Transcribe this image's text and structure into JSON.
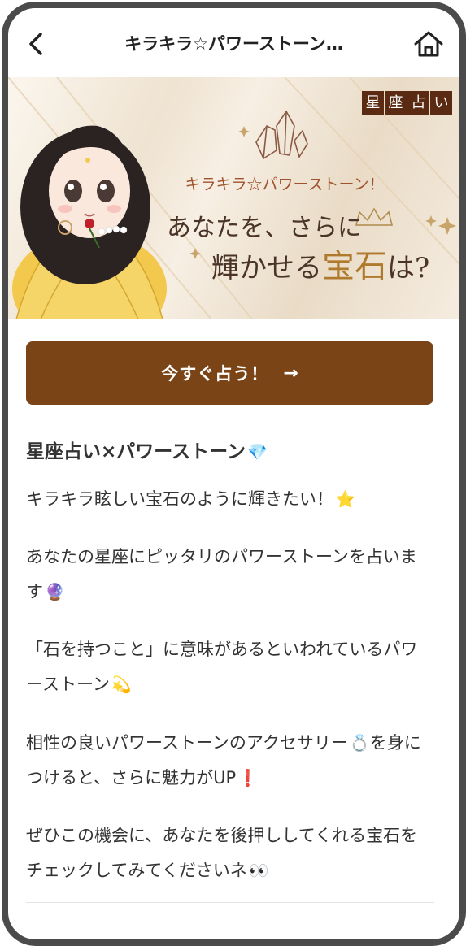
{
  "header": {
    "title": "キラキラ☆パワーストーン…",
    "back_icon": "chevron-left-icon",
    "home_icon": "home-icon"
  },
  "banner": {
    "badge": [
      "星",
      "座",
      "占",
      "い"
    ],
    "subtitle": "キラキラ☆パワーストーン！",
    "line1": "あなたを、さらに",
    "line2_a": "輝かせる",
    "line2_b": "宝石",
    "line2_c": "は?"
  },
  "cta": {
    "label": "今すぐ占う！",
    "arrow": "→",
    "color": "#7a4417"
  },
  "content": {
    "title": "星座占い×パワーストーン",
    "title_emoji": "💎",
    "p1": {
      "text": "キラキラ眩しい宝石のように輝きたい！",
      "emoji": "⭐"
    },
    "p2": {
      "text": "あなたの星座にピッタリのパワーストーンを占います",
      "emoji": "🔮"
    },
    "p3": {
      "text": "「石を持つこと」に意味があるといわれているパワーストーン",
      "emoji": "💫"
    },
    "p4": {
      "text_a": "相性の良いパワーストーンのアクセサリー",
      "emoji_a": "💍",
      "text_b": "を身につけると、さらに魅力がUP",
      "emoji_b": "❗"
    },
    "p5": {
      "text": "ぜひこの機会に、あなたを後押ししてくれる宝石をチェックしてみてくださいネ",
      "emoji": "👀"
    }
  }
}
